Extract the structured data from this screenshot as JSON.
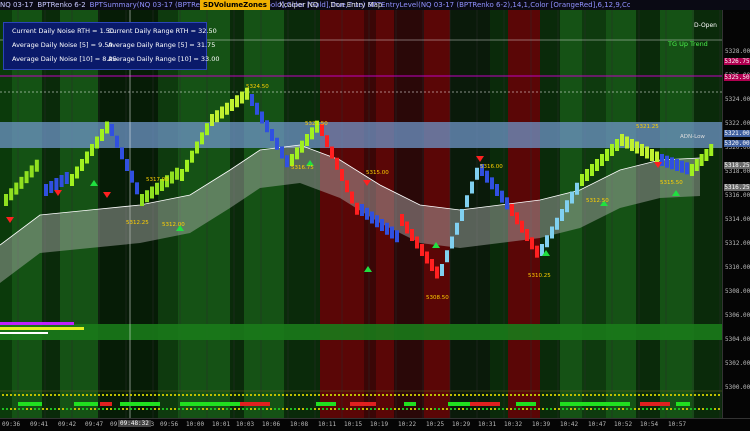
{
  "titlebar": {
    "instrument": "NQ 03-17",
    "bars_type": "BPTRenko 6-2",
    "indicators_text": "BPTSummary(NQ 03-17 (BPTRenko 6-2),12,Color [Gold],Color [Gold],True,True)  BPTEntryLevel(NQ 03-17 (BPTRenko 6-2),14,1,Color [OrangeRed],6,12,9,Color [Gray],False,Color [Chartreuse])  SZT_SDVolumeZones  PivotLines(NQ 03-17)  BPTRenko 6-2  TickSpeed(NQ 03-17 (BPTRenko 6-2),True,True,True)",
    "tabs": [
      {
        "label": "SDVolumeZones",
        "active": true
      },
      {
        "label": "Xcalper NQ",
        "active": false
      },
      {
        "label": "Don Entry Map",
        "active": false
      }
    ]
  },
  "stats": {
    "current_noise": "Current Daily Noise RTH = 1.50",
    "current_range": "Current Daily Range RTH = 32.50",
    "avg_noise_5": "Average Daily Noise [5] = 9.50",
    "avg_range_5": "Average Daily Range [5] = 31.75",
    "avg_noise_10": "Average Daily Noise [10] = 8.25",
    "avg_range_10": "Average Daily Range [10] = 33.00"
  },
  "chart_labels": {
    "tg_up_trend": "TG Up Trend",
    "d_open": "D-Open",
    "adn_low": "ADN-Low",
    "price_5324_50": "5324.50",
    "price_5321_50": "5321.50",
    "price_5321_25": "5321.25",
    "price_5317_00": "5317.00",
    "price_5316_00": "5316.00",
    "price_5316_75": "5316.75",
    "price_5315_50": "5315.50",
    "price_5312_25": "5312.25",
    "price_5312_00": "5312.00",
    "price_5310_25": "5310.25",
    "price_5308_50": "5308.50",
    "price_5315_00": "5315.00",
    "price_5312_50": "5312.50"
  },
  "price_axis": {
    "labels": [
      "5328.00",
      "5326.00",
      "5324.00",
      "5322.00",
      "5320.00",
      "5318.00",
      "5316.00",
      "5314.00",
      "5312.00",
      "5310.00",
      "5308.00",
      "5306.00",
      "5304.00",
      "5302.00",
      "5300.00"
    ],
    "badges": [
      {
        "text": "5326.75",
        "color": "#b00050"
      },
      {
        "text": "5325.50",
        "color": "#b00050"
      },
      {
        "text": "5321.00",
        "color": "#4060a0"
      },
      {
        "text": "5320.00",
        "color": "#4060a0"
      },
      {
        "text": "5318.25",
        "color": "#6a6a6a"
      },
      {
        "text": "5316.25",
        "color": "#6a6a6a"
      }
    ]
  },
  "time_axis": {
    "labels": [
      "09:36",
      "09:41",
      "09:42",
      "09:47",
      "09:51",
      "09:53",
      "09:56",
      "10:00",
      "10:01",
      "10:03",
      "10:06",
      "10:08",
      "10:11",
      "10:15",
      "10:19",
      "10:22",
      "10:25",
      "10:29",
      "10:31",
      "10:32",
      "10:39",
      "10:42",
      "10:47",
      "10:52",
      "10:54",
      "10:57"
    ],
    "cursor_badge": "09:48:32"
  }
}
